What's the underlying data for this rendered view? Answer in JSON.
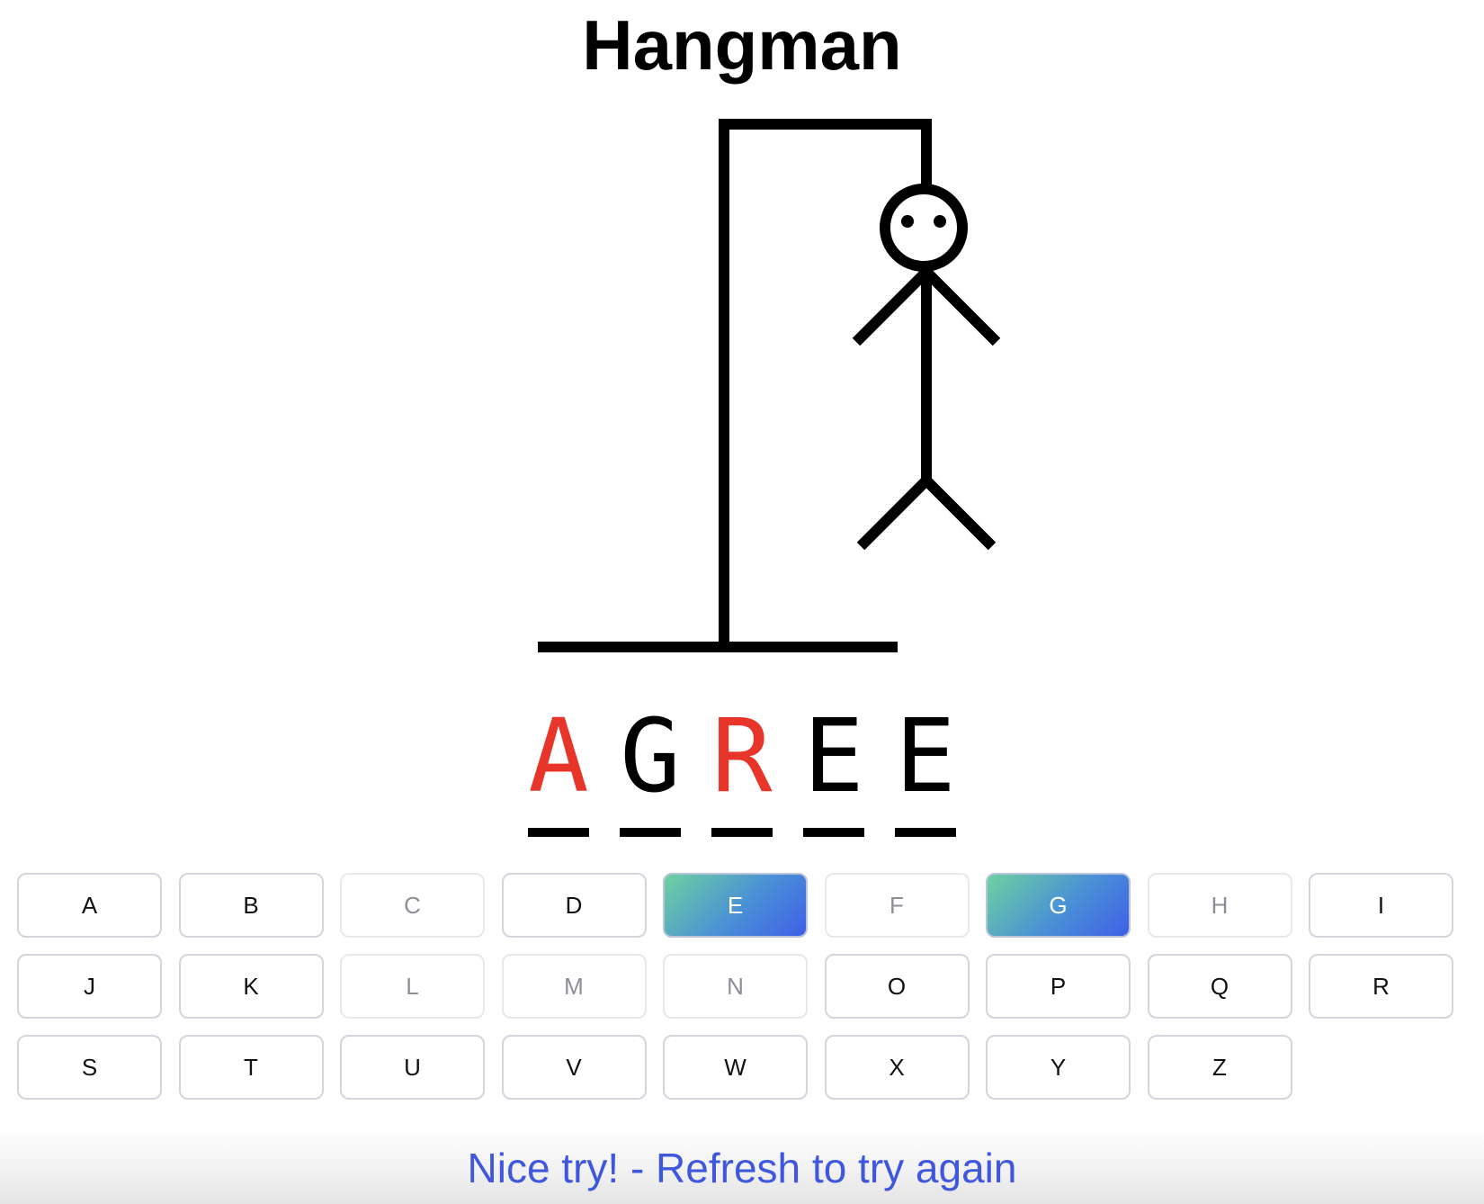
{
  "title": "Hangman",
  "word": [
    {
      "letter": "A",
      "status": "missed"
    },
    {
      "letter": "G",
      "status": "guessed"
    },
    {
      "letter": "R",
      "status": "missed"
    },
    {
      "letter": "E",
      "status": "guessed"
    },
    {
      "letter": "E",
      "status": "guessed"
    }
  ],
  "keys": [
    {
      "label": "A",
      "state": "available"
    },
    {
      "label": "B",
      "state": "available"
    },
    {
      "label": "C",
      "state": "wrong"
    },
    {
      "label": "D",
      "state": "available"
    },
    {
      "label": "E",
      "state": "correct"
    },
    {
      "label": "F",
      "state": "wrong"
    },
    {
      "label": "G",
      "state": "correct"
    },
    {
      "label": "H",
      "state": "wrong"
    },
    {
      "label": "I",
      "state": "available"
    },
    {
      "label": "J",
      "state": "available"
    },
    {
      "label": "K",
      "state": "available"
    },
    {
      "label": "L",
      "state": "wrong"
    },
    {
      "label": "M",
      "state": "wrong"
    },
    {
      "label": "N",
      "state": "wrong"
    },
    {
      "label": "O",
      "state": "available"
    },
    {
      "label": "P",
      "state": "available"
    },
    {
      "label": "Q",
      "state": "available"
    },
    {
      "label": "R",
      "state": "available"
    },
    {
      "label": "S",
      "state": "available"
    },
    {
      "label": "T",
      "state": "available"
    },
    {
      "label": "U",
      "state": "available"
    },
    {
      "label": "V",
      "state": "available"
    },
    {
      "label": "W",
      "state": "available"
    },
    {
      "label": "X",
      "state": "available"
    },
    {
      "label": "Y",
      "state": "available"
    },
    {
      "label": "Z",
      "state": "available"
    }
  ],
  "message": "Nice try! - Refresh to try again",
  "colors": {
    "missed_letter": "#e8352a",
    "message": "#3f57dc",
    "correct_key_gradient": [
      "#6fd1a0",
      "#3f5fe6"
    ]
  }
}
